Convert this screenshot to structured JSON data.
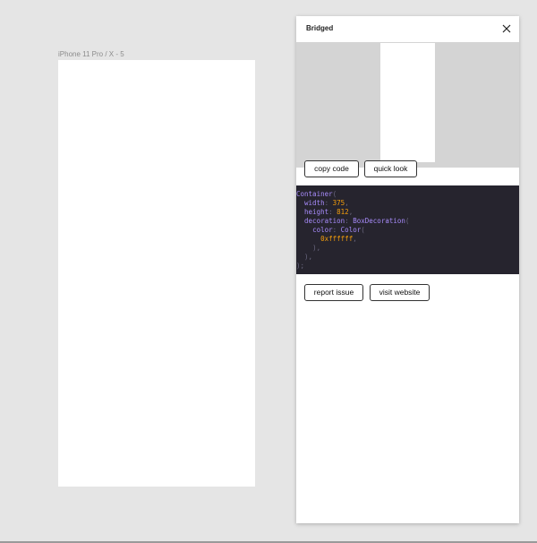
{
  "canvas": {
    "frame_label": "iPhone 11 Pro / X - 5"
  },
  "plugin": {
    "title": "Bridged",
    "close_icon": "close-icon",
    "buttons": {
      "copy_code": "copy code",
      "quick_look": "quick look",
      "report_issue": "report issue",
      "visit_website": "visit website"
    },
    "code": {
      "class_name": "Container",
      "width_prop": "width",
      "width_val": "375",
      "height_prop": "height",
      "height_val": "812",
      "decoration_prop": "decoration",
      "decoration_class": "BoxDecoration",
      "color_prop": "color",
      "color_class": "Color",
      "color_val": "0xffffff"
    }
  },
  "colors": {
    "canvas_bg": "#e5e5e5",
    "panel_bg": "#ffffff",
    "preview_bg": "#d4d4d4",
    "code_bg": "#26242e",
    "code_keyword": "#a78bfa",
    "code_number": "#f59e0b"
  }
}
